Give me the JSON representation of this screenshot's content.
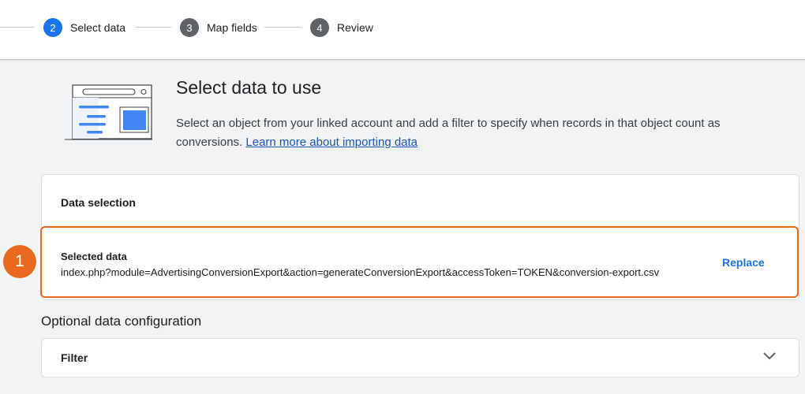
{
  "stepper": {
    "steps": [
      {
        "number": "2",
        "label": "Select data",
        "active": true
      },
      {
        "number": "3",
        "label": "Map fields",
        "active": false
      },
      {
        "number": "4",
        "label": "Review",
        "active": false
      }
    ]
  },
  "intro": {
    "title": "Select data to use",
    "description": "Select an object from your linked account and add a filter to specify when records in that object count as conversions.",
    "link_text": "Learn more about importing data"
  },
  "data_selection": {
    "heading": "Data selection",
    "selected_title": "Selected data",
    "selected_value": "index.php?module=AdvertisingConversionExport&action=generateConversionExport&accessToken=TOKEN&conversion-export.csv",
    "replace_label": "Replace"
  },
  "callout": {
    "number": "1"
  },
  "optional": {
    "heading": "Optional data configuration",
    "filter_label": "Filter"
  },
  "colors": {
    "active_step": "#1a73e8",
    "inactive_step": "#5f6368",
    "accent": "#e8681f",
    "link": "#1a57b8",
    "page_bg": "#f1f3f4"
  },
  "icons": {
    "illustration": "data-table-illustration",
    "filter_toggle": "chevron-down-icon"
  }
}
